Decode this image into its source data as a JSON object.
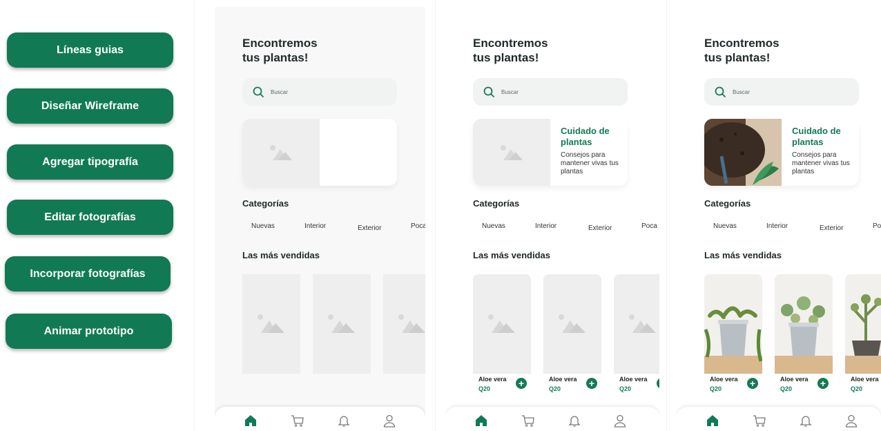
{
  "steps": [
    {
      "label": "Líneas guias"
    },
    {
      "label": "Diseñar Wireframe"
    },
    {
      "label": "Agregar tipografía"
    },
    {
      "label": "Editar fotografías"
    },
    {
      "label": "Incorporar fotografías"
    },
    {
      "label": "Animar prototipo"
    }
  ],
  "screen": {
    "title": "Encontremos\ntus plantas!",
    "search_placeholder": "Buscar",
    "card_title": "Cuidado de plantas",
    "card_desc": "Consejos para mantener vivas tus plantas",
    "categories_title": "Categorías",
    "categories": [
      "Nuevas",
      "Interior",
      "Exterior",
      "Poca luz"
    ],
    "bestsellers_title": "Las más vendidas",
    "products": [
      {
        "name": "Aloe vera",
        "price": "Q20"
      },
      {
        "name": "Aloe vera",
        "price": "Q20"
      },
      {
        "name": "Aloe vera",
        "price": "Q20"
      }
    ],
    "add_symbol": "+"
  },
  "colors": {
    "primary": "#117a55",
    "placeholder": "#eeeeee",
    "text": "#202a2b"
  },
  "nav_icons": [
    "home-icon",
    "cart-icon",
    "bell-icon",
    "user-icon"
  ]
}
